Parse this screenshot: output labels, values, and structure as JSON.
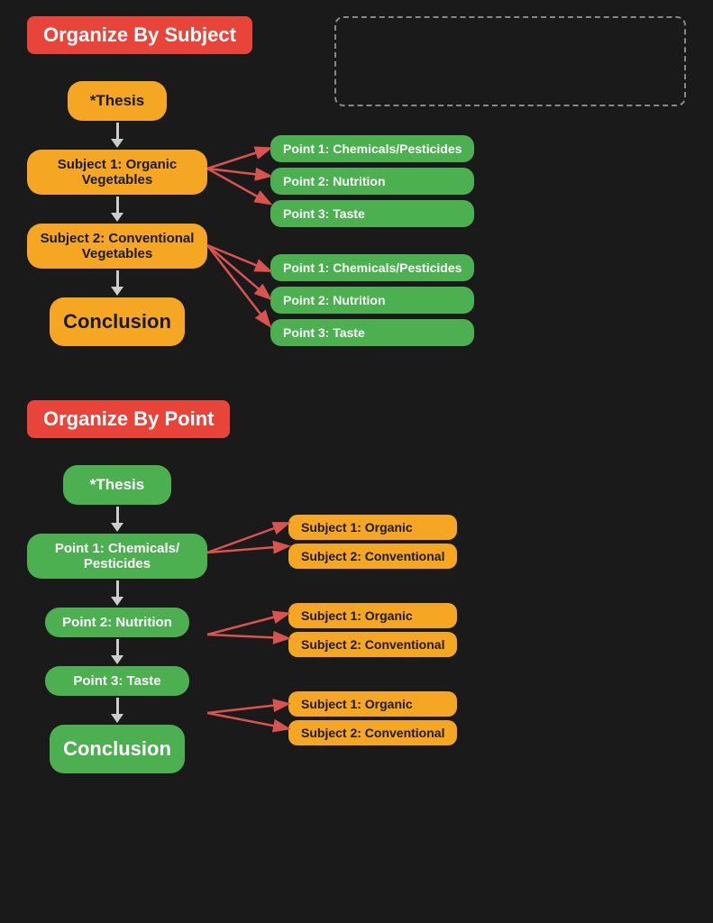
{
  "section1": {
    "title": "Organize By Subject",
    "nodes": {
      "thesis": "*Thesis",
      "subject1": "Subject 1: Organic Vegetables",
      "subject2": "Subject 2: Conventional Vegetables",
      "conclusion": "Conclusion"
    },
    "right_group1": [
      "Point 1: Chemicals/Pesticides",
      "Point 2: Nutrition",
      "Point 3: Taste"
    ],
    "right_group2": [
      "Point 1: Chemicals/Pesticides",
      "Point 2: Nutrition",
      "Point 3: Taste"
    ]
  },
  "section2": {
    "title": "Organize By Point",
    "nodes": {
      "thesis": "*Thesis",
      "point1": "Point 1: Chemicals/ Pesticides",
      "point2": "Point 2: Nutrition",
      "point3": "Point 3: Taste",
      "conclusion": "Conclusion"
    },
    "right_pair1": [
      "Subject 1: Organic",
      "Subject 2: Conventional"
    ],
    "right_pair2": [
      "Subject 1: Organic",
      "Subject 2: Conventional"
    ],
    "right_pair3": [
      "Subject 1: Organic",
      "Subject 2: Conventional"
    ]
  },
  "colors": {
    "orange": "#f5a623",
    "green": "#4caf50",
    "red": "#e8443a",
    "arrow": "#d9534f",
    "arrow_white": "#cccccc",
    "bg": "#1a1a1a"
  }
}
